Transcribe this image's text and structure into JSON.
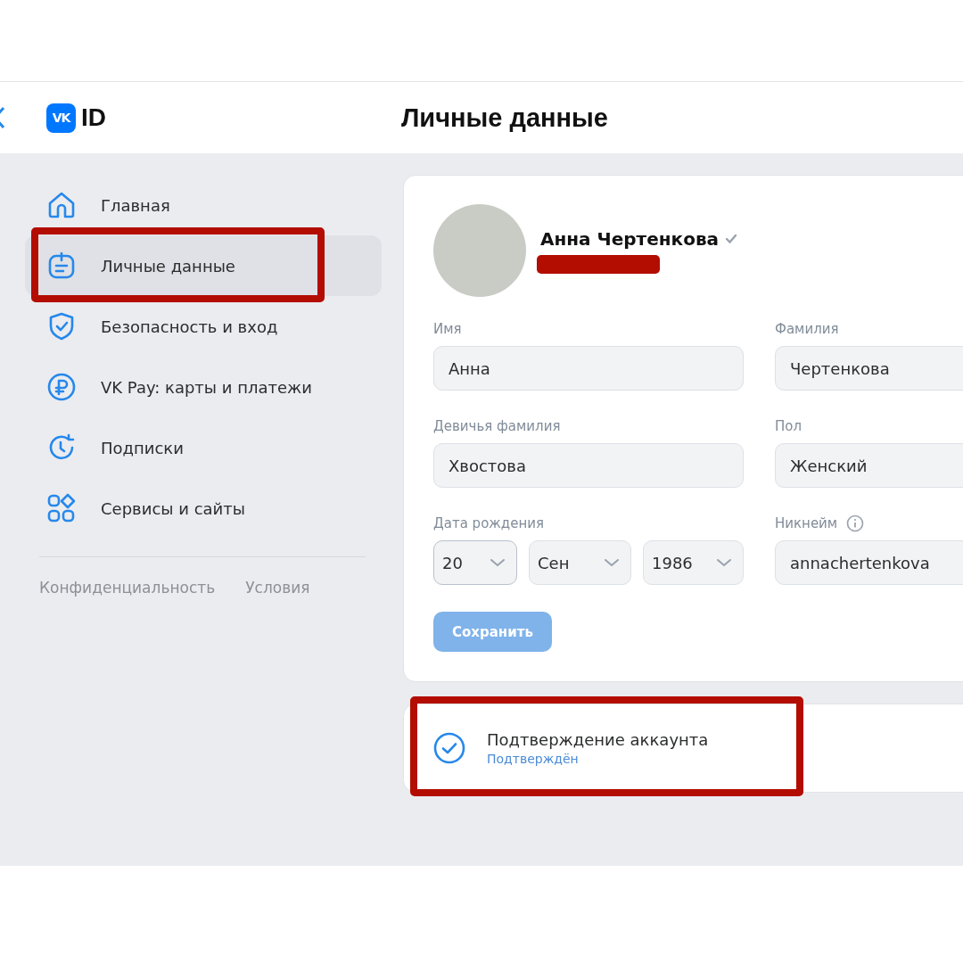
{
  "header": {
    "logo_badge": "VK",
    "logo_text": "ID",
    "title": "Личные данные"
  },
  "sidebar": {
    "items": [
      {
        "kind": "home",
        "label": "Главная",
        "selected": false,
        "highlighted": false
      },
      {
        "kind": "profile",
        "label": "Личные данные",
        "selected": true,
        "highlighted": true
      },
      {
        "kind": "shield",
        "label": "Безопасность и вход",
        "selected": false,
        "highlighted": false
      },
      {
        "kind": "ruble",
        "label": "VK Pay: карты и платежи",
        "selected": false,
        "highlighted": false
      },
      {
        "kind": "subscription",
        "label": "Подписки",
        "selected": false,
        "highlighted": false
      },
      {
        "kind": "services",
        "label": "Сервисы и сайты",
        "selected": false,
        "highlighted": false
      }
    ],
    "footer_links": [
      "Конфиденциальность",
      "Условия"
    ]
  },
  "profile": {
    "name": "Анна Чертенкова",
    "verified": true,
    "redacted": true
  },
  "fields": [
    {
      "kind": "text",
      "label": "Имя",
      "value": "Анна",
      "info": false
    },
    {
      "kind": "text",
      "label": "Фамилия",
      "value": "Чертенкова",
      "info": false
    },
    {
      "kind": "text",
      "label": "Девичья фамилия",
      "value": "Хвостова",
      "info": false
    },
    {
      "kind": "text",
      "label": "Пол",
      "value": "Женский",
      "info": false
    },
    {
      "kind": "date",
      "label": "Дата рождения",
      "parts": [
        "20",
        "Сен",
        "1986"
      ],
      "info": false
    },
    {
      "kind": "text",
      "label": "Никнейм",
      "value": "annachertenkova",
      "info": true
    }
  ],
  "save_button": {
    "label": "Сохранить",
    "disabled": true
  },
  "verification": {
    "title": "Подтверждение аккаунта",
    "status": "Подтверждён",
    "highlighted": true
  }
}
